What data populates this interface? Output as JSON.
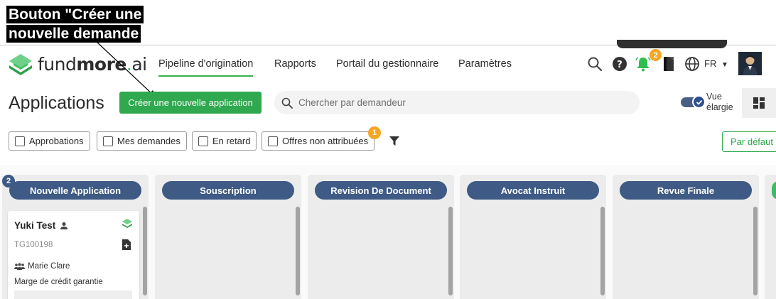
{
  "annotation": {
    "line1": "Bouton \"Créer une",
    "line2": "nouvelle demande"
  },
  "brand": {
    "name_light": "fund",
    "name_bold": "more",
    "suffix": "ai",
    "accent_color": "#3fbf5f"
  },
  "nav": {
    "items": [
      {
        "label": "Pipeline d'origination",
        "active": true
      },
      {
        "label": "Rapports",
        "active": false
      },
      {
        "label": "Portail du gestionnaire",
        "active": false
      },
      {
        "label": "Paramètres",
        "active": false
      }
    ],
    "notifications_count": "2",
    "language": "FR",
    "icons": [
      "search-icon",
      "help-icon",
      "bell-icon",
      "notebook-icon",
      "globe-icon",
      "chevron-down-icon"
    ]
  },
  "page": {
    "title": "Applications",
    "create_button": "Créer une nouvelle application",
    "search_placeholder": "Chercher par demandeur",
    "toggle_label_1": "Vue",
    "toggle_label_2": "élargie"
  },
  "filters": {
    "items": [
      "Approbations",
      "Mes demandes",
      "En retard",
      "Offres non attribuées"
    ],
    "unassigned_count": "1",
    "sort_label": "Par défaut ("
  },
  "board": {
    "columns": [
      {
        "title": "Nouvelle Application",
        "count": "2"
      },
      {
        "title": "Souscription"
      },
      {
        "title": "Revision De Document"
      },
      {
        "title": "Avocat Instruit"
      },
      {
        "title": "Revue Finale"
      }
    ],
    "card": {
      "name": "Yuki Test",
      "id": "TG100198",
      "agent": "Marie Clare",
      "product": "Marge de crédit garantie"
    }
  },
  "colors": {
    "primary_green": "#2fa84f",
    "column_header": "#3e5a85",
    "badge": "#f5a623"
  }
}
